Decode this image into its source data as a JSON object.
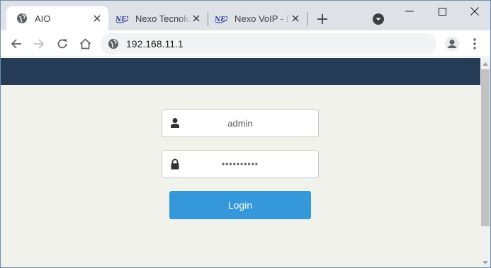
{
  "browser": {
    "tabs": [
      {
        "title": "AIO",
        "favicon": "globe-icon",
        "active": true
      },
      {
        "title": "Nexo Tecnolog",
        "favicon": "nexo-logo-icon",
        "active": false
      },
      {
        "title": "Nexo VoIP - De",
        "favicon": "nexo-logo-icon",
        "active": false
      }
    ],
    "address": "192.168.11.1",
    "colors": {
      "tabstrip": "#dee1e6",
      "omnibox": "#f1f3f4"
    }
  },
  "page": {
    "colors": {
      "header": "#263c56",
      "background": "#f2f2ec",
      "button": "#3498db"
    },
    "username": {
      "value": "admin",
      "icon": "user-icon"
    },
    "password": {
      "value": "••••••••••",
      "icon": "lock-icon"
    },
    "login_label": "Login"
  }
}
